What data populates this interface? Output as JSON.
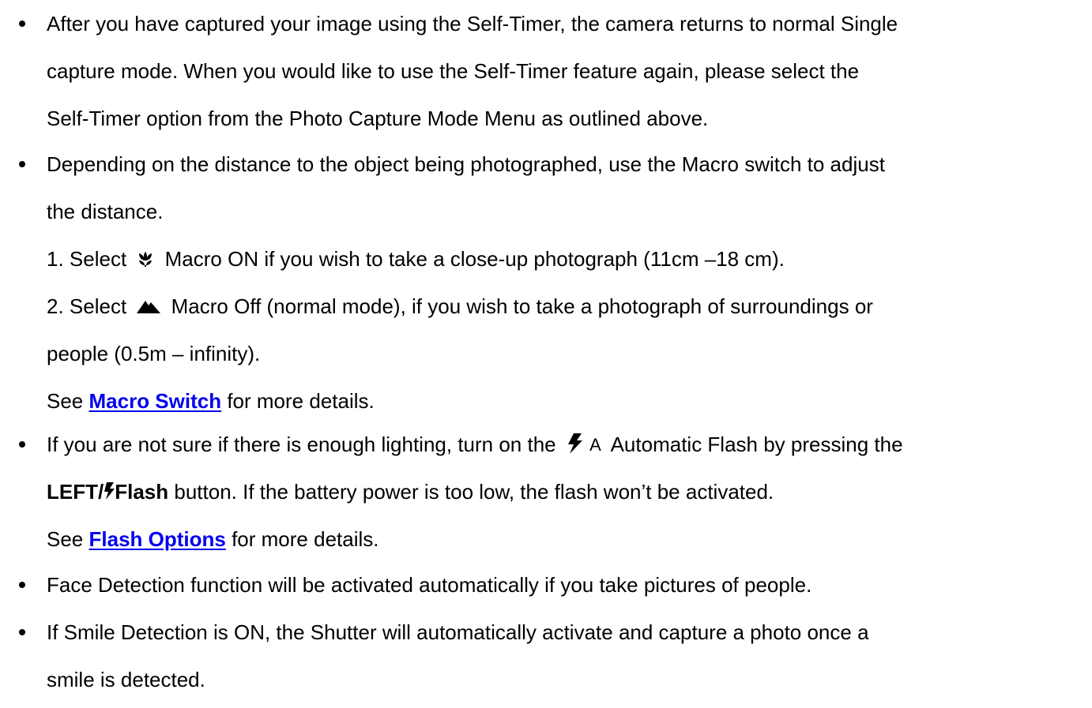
{
  "items": [
    {
      "lines": [
        "After you have captured your image using the Self-Timer, the camera returns to normal Single",
        "capture mode. When you would like to use the Self-Timer feature again, please select the",
        "Self-Timer option from the Photo Capture Mode Menu as outlined above."
      ]
    },
    {
      "lines": [
        "Depending on the distance to the object being photographed, use the Macro switch to adjust",
        "the distance."
      ],
      "sub": {
        "macro_on_prefix": "1. Select",
        "macro_on_text": "Macro ON if you wish to take a close-up photograph (11cm –18 cm).",
        "macro_off_prefix": "2. Select",
        "macro_off_text": "Macro Off (normal mode), if you wish to take a photograph of surroundings or",
        "macro_off_cont": "people (0.5m – infinity).",
        "see_prefix": "See",
        "see_link": "Macro Switch",
        "see_suffix": "for more details."
      }
    },
    {
      "line1_prefix": "If you are not sure if there is enough lighting, turn on the",
      "auto_flash_letter": "A",
      "line1_suffix": "Automatic Flash by pressing the",
      "line2_bold_left": "LEFT/",
      "line2_bold_flash": "Flash",
      "line2_rest": "button. If the battery power is too low, the flash won’t be activated.",
      "see_prefix": "See",
      "see_link": "Flash Options",
      "see_suffix": "for more details."
    },
    {
      "lines": [
        "Face Detection function will be activated automatically if you take pictures of people."
      ]
    },
    {
      "lines": [
        "If Smile Detection is ON, the Shutter will automatically activate and capture a photo once a",
        "smile is detected."
      ]
    }
  ],
  "icons": {
    "macro_on": "macro-flower-icon",
    "macro_off": "macro-mountain-icon",
    "auto_flash": "auto-flash-icon",
    "flash": "flash-icon"
  },
  "colors": {
    "link": "#0000ee",
    "text": "#000000"
  }
}
